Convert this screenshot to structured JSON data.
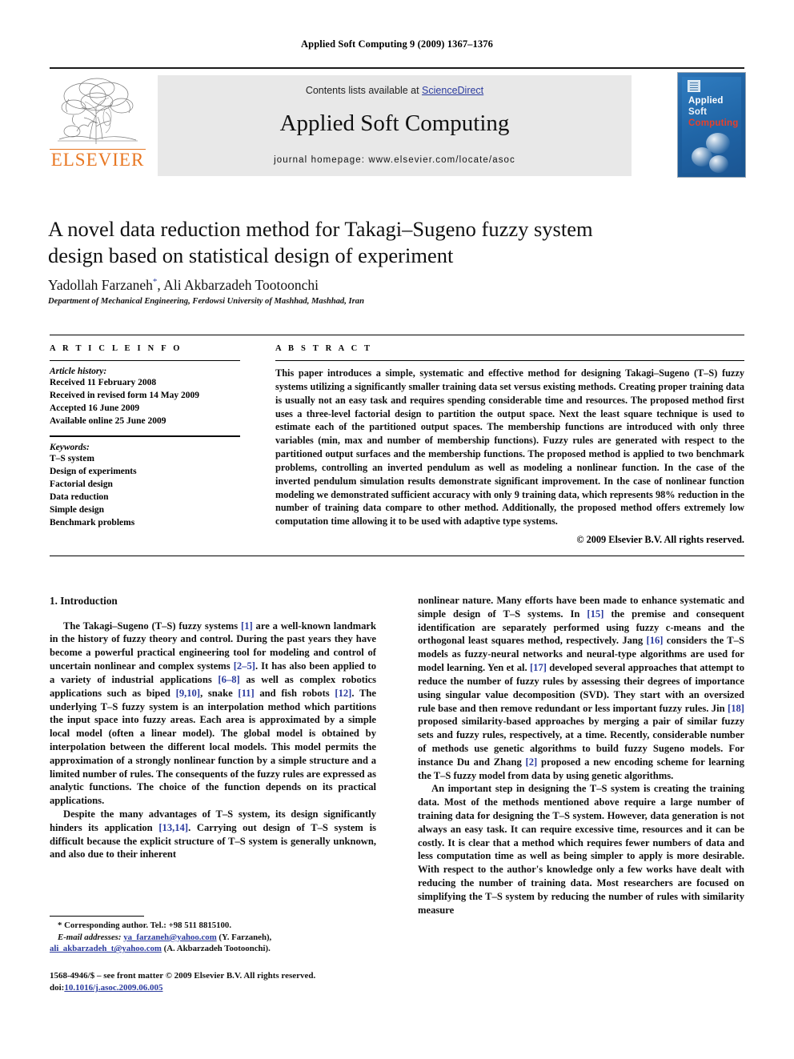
{
  "running_head": "Applied Soft Computing 9 (2009) 1367–1376",
  "masthead": {
    "contents_prefix": "Contents lists available at ",
    "sciencedirect": "ScienceDirect",
    "journal_title": "Applied Soft Computing",
    "homepage": "journal homepage: www.elsevier.com/locate/asoc",
    "publisher_name": "ELSEVIER",
    "cover": {
      "line1": "Applied",
      "line2": "Soft",
      "line3": "Computing"
    },
    "accent_link_color": "#2b3b9e",
    "publisher_color": "#E87722",
    "band_color": "#e8e8e8",
    "cover_blue": "#1d5f9f",
    "cover_red": "#e8402a"
  },
  "article": {
    "title": "A novel data reduction method for Takagi–Sugeno fuzzy system design based on statistical design of experiment",
    "authors": "Yadollah Farzaneh, Ali Akbarzadeh Tootoonchi",
    "author_marker": "*",
    "affiliation": "Department of Mechanical Engineering, Ferdowsi University of Mashhad, Mashhad, Iran"
  },
  "article_info": {
    "heading": "A R T I C L E   I N F O",
    "history_label": "Article history:",
    "history": [
      "Received 11 February 2008",
      "Received in revised form 14 May 2009",
      "Accepted 16 June 2009",
      "Available online 25 June 2009"
    ],
    "keywords_label": "Keywords:",
    "keywords": [
      "T–S system",
      "Design of experiments",
      "Factorial design",
      "Data reduction",
      "Simple design",
      "Benchmark problems"
    ]
  },
  "abstract": {
    "heading": "A B S T R A C T",
    "text": "This paper introduces a simple, systematic and effective method for designing Takagi–Sugeno (T–S) fuzzy systems utilizing a significantly smaller training data set versus existing methods. Creating proper training data is usually not an easy task and requires spending considerable time and resources. The proposed method first uses a three-level factorial design to partition the output space. Next the least square technique is used to estimate each of the partitioned output spaces. The membership functions are introduced with only three variables (min, max and number of membership functions). Fuzzy rules are generated with respect to the partitioned output surfaces and the membership functions. The proposed method is applied to two benchmark problems, controlling an inverted pendulum as well as modeling a nonlinear function. In the case of the inverted pendulum simulation results demonstrate significant improvement. In the case of nonlinear function modeling we demonstrated sufficient accuracy with only 9 training data, which represents 98% reduction in the number of training data compare to other method. Additionally, the proposed method offers extremely low computation time allowing it to be used with adaptive type systems.",
    "copyright": "© 2009 Elsevier B.V. All rights reserved."
  },
  "body": {
    "section_title": "1. Introduction",
    "left_paragraphs": [
      "The Takagi–Sugeno (T–S) fuzzy systems [1] are a well-known landmark in the history of fuzzy theory and control. During the past years they have become a powerful practical engineering tool for modeling and control of uncertain nonlinear and complex systems [2–5]. It has also been applied to a variety of industrial applications [6–8] as well as complex robotics applications such as biped [9,10], snake [11] and fish robots [12]. The underlying T–S fuzzy system is an interpolation method which partitions the input space into fuzzy areas. Each area is approximated by a simple local model (often a linear model). The global model is obtained by interpolation between the different local models. This model permits the approximation of a strongly nonlinear function by a simple structure and a limited number of rules. The consequents of the fuzzy rules are expressed as analytic functions. The choice of the function depends on its practical applications.",
      "Despite the many advantages of T–S system, its design significantly hinders its application [13,14]. Carrying out design of T–S system is difficult because the explicit structure of T–S system is generally unknown, and also due to their inherent"
    ],
    "right_paragraphs": [
      "nonlinear nature. Many efforts have been made to enhance systematic and simple design of T–S systems. In [15] the premise and consequent identification are separately performed using fuzzy c-means and the orthogonal least squares method, respectively. Jang [16] considers the T–S models as fuzzy-neural networks and neural-type algorithms are used for model learning. Yen et al. [17] developed several approaches that attempt to reduce the number of fuzzy rules by assessing their degrees of importance using singular value decomposition (SVD). They start with an oversized rule base and then remove redundant or less important fuzzy rules. Jin [18] proposed similarity-based approaches by merging a pair of similar fuzzy sets and fuzzy rules, respectively, at a time. Recently, considerable number of methods use genetic algorithms to build fuzzy Sugeno models. For instance Du and Zhang [2] proposed a new encoding scheme for learning the T–S fuzzy model from data by using genetic algorithms.",
      "An important step in designing the T–S system is creating the training data. Most of the methods mentioned above require a large number of training data for designing the T–S system. However, data generation is not always an easy task. It can require excessive time, resources and it can be costly. It is clear that a method which requires fewer numbers of data and less computation time as well as being simpler to apply is more desirable. With respect to the author's knowledge only a few works have dealt with reducing the number of training data. Most researchers are focused on simplifying the T–S system by reducing the number of rules with similarity measure"
    ]
  },
  "footnotes": {
    "corresponding": "* Corresponding author. Tel.: +98 511 8815100.",
    "email_label": "E-mail addresses:",
    "email_1": "ya_farzaneh@yahoo.com",
    "email_1_owner": " (Y. Farzaneh),",
    "email_2": "ali_akbarzadeh_t@yahoo.com",
    "email_2_owner": " (A. Akbarzadeh Tootoonchi).",
    "imprint_line1": "1568-4946/$ – see front matter © 2009 Elsevier B.V. All rights reserved.",
    "imprint_doi_label": "doi:",
    "imprint_doi": "10.1016/j.asoc.2009.06.005"
  }
}
